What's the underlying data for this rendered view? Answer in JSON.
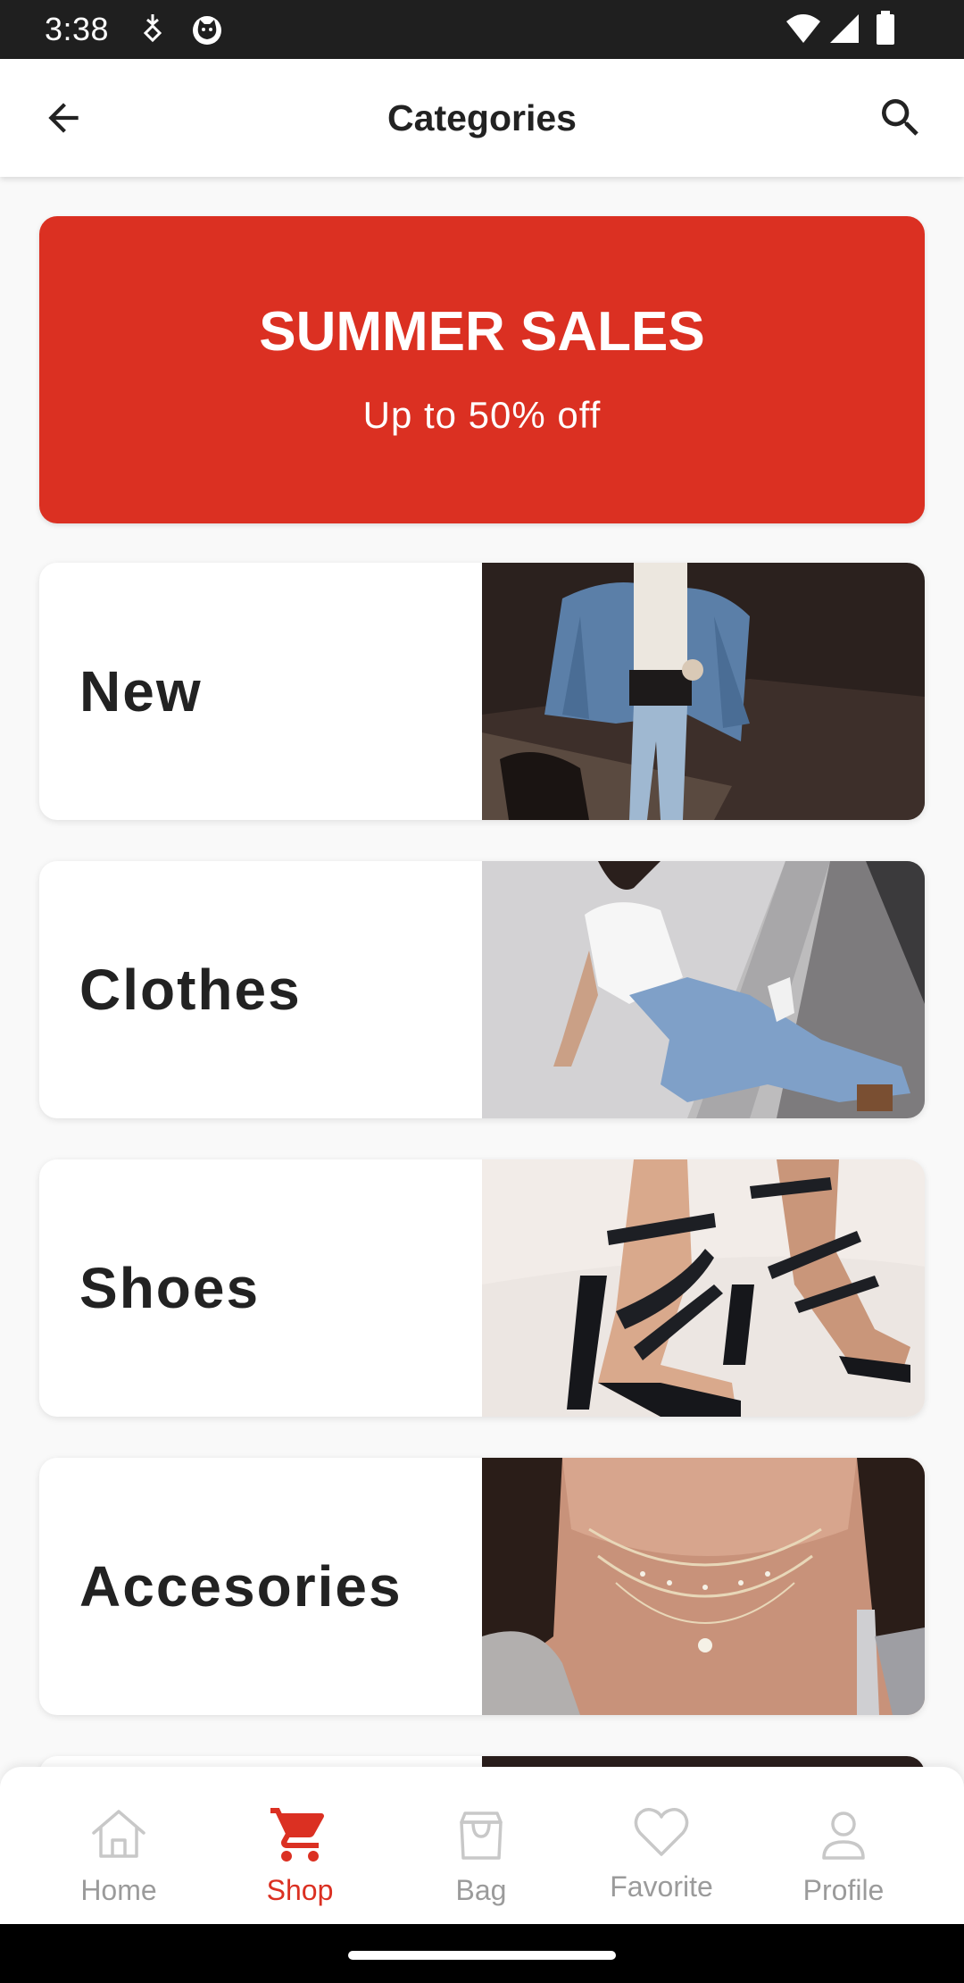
{
  "status_bar": {
    "time": "3:38"
  },
  "app_bar": {
    "title": "Categories",
    "back_icon": "arrow-left-icon",
    "search_icon": "search-icon"
  },
  "banner": {
    "title": "SUMMER SALES",
    "subtitle": "Up to 50% off",
    "color": "#db3022"
  },
  "categories": [
    {
      "label": "New",
      "image": "photo-woman-denim-jacket"
    },
    {
      "label": "Clothes",
      "image": "photo-woman-white-shirt-jeans"
    },
    {
      "label": "Shoes",
      "image": "photo-black-strappy-heels"
    },
    {
      "label": "Accesories",
      "image": "photo-layered-necklace"
    }
  ],
  "bottom_nav": {
    "items": [
      {
        "label": "Home",
        "icon": "home-icon",
        "active": false
      },
      {
        "label": "Shop",
        "icon": "cart-icon",
        "active": true
      },
      {
        "label": "Bag",
        "icon": "bag-icon",
        "active": false
      },
      {
        "label": "Favorite",
        "icon": "heart-icon",
        "active": false
      },
      {
        "label": "Profile",
        "icon": "profile-icon",
        "active": false
      }
    ],
    "active_color": "#db3022",
    "inactive_color": "#9b9b9b"
  }
}
